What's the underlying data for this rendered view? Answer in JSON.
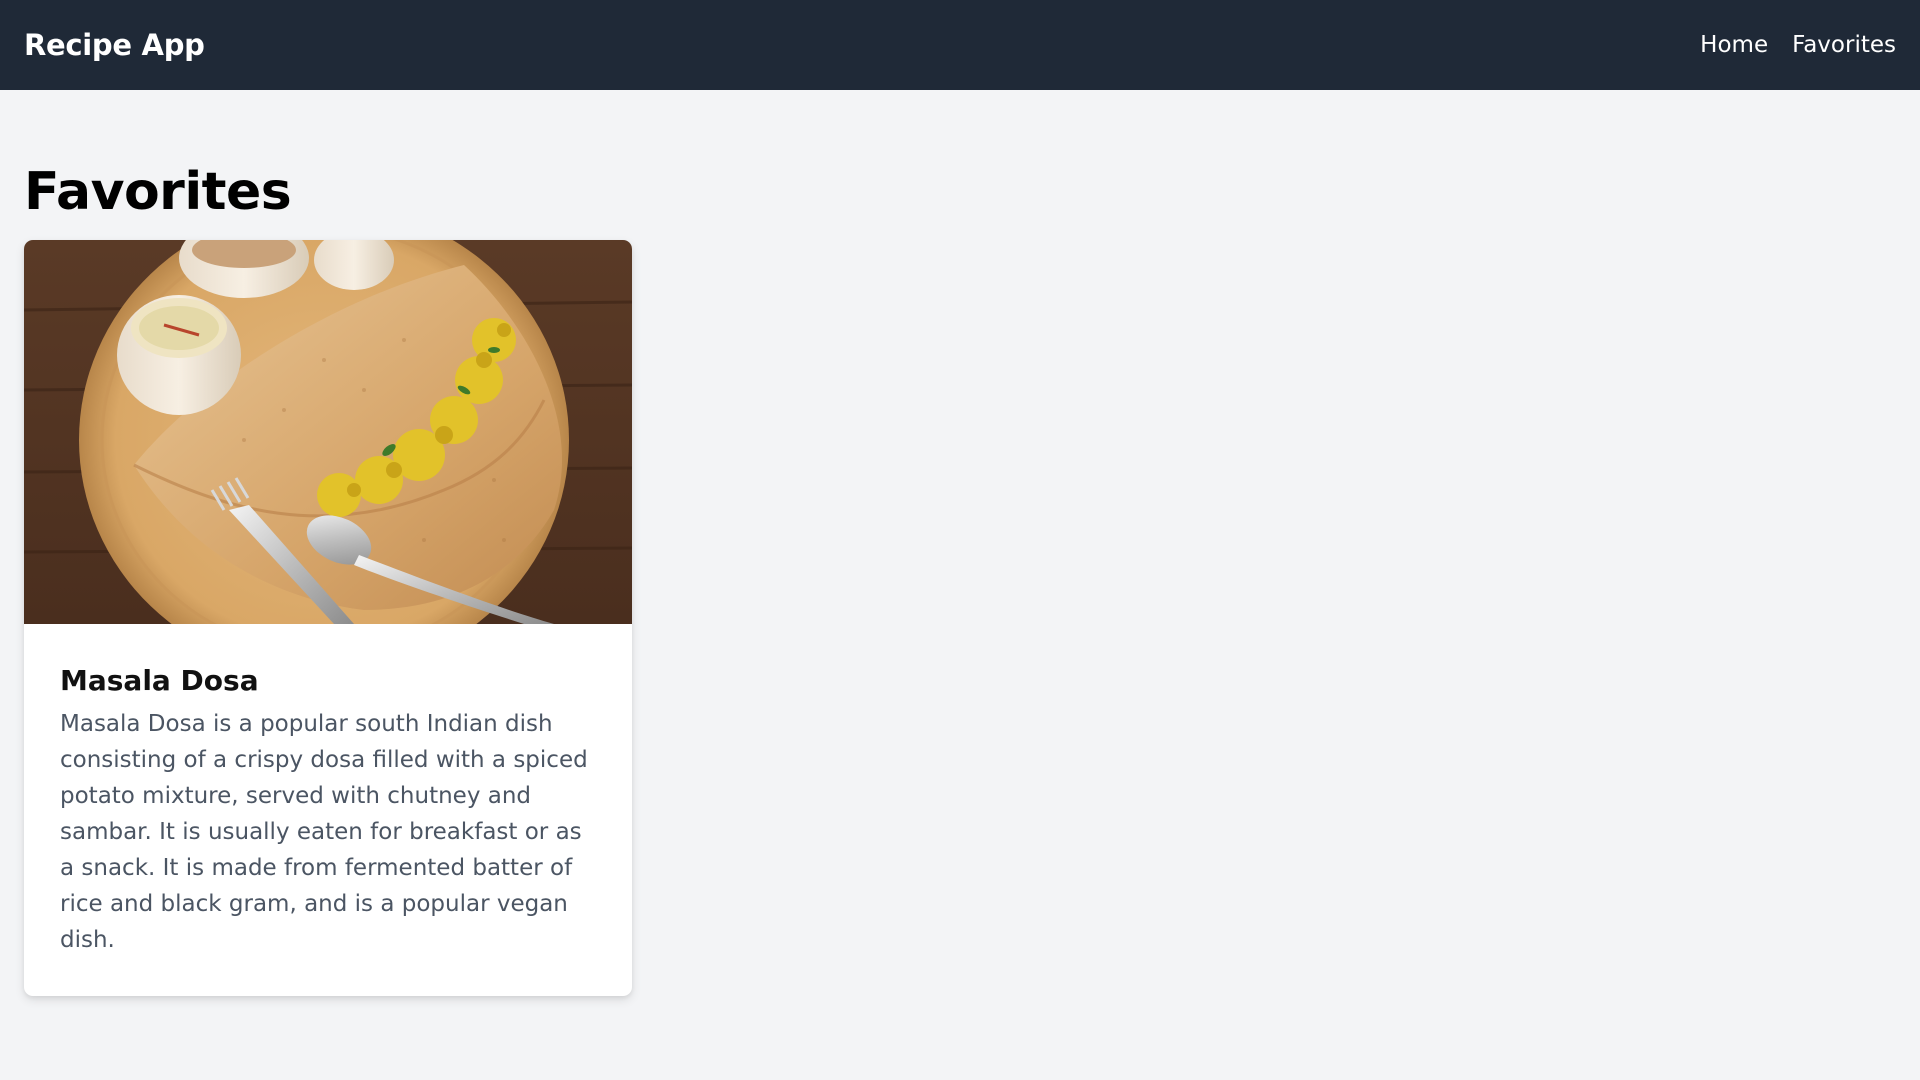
{
  "navbar": {
    "brand": "Recipe App",
    "links": [
      {
        "label": "Home"
      },
      {
        "label": "Favorites"
      }
    ]
  },
  "main": {
    "title": "Favorites",
    "cards": [
      {
        "title": "Masala Dosa",
        "description": "Masala Dosa is a popular south Indian dish consisting of a crispy dosa filled with a spiced potato mixture, served with chutney and sambar. It is usually eaten for breakfast or as a snack. It is made from fermented batter of rice and black gram, and is a popular vegan dish."
      }
    ]
  },
  "colors": {
    "navbar_bg": "#1f2937",
    "page_bg": "#f3f4f6",
    "card_bg": "#ffffff",
    "desc_text": "#4b5563"
  }
}
